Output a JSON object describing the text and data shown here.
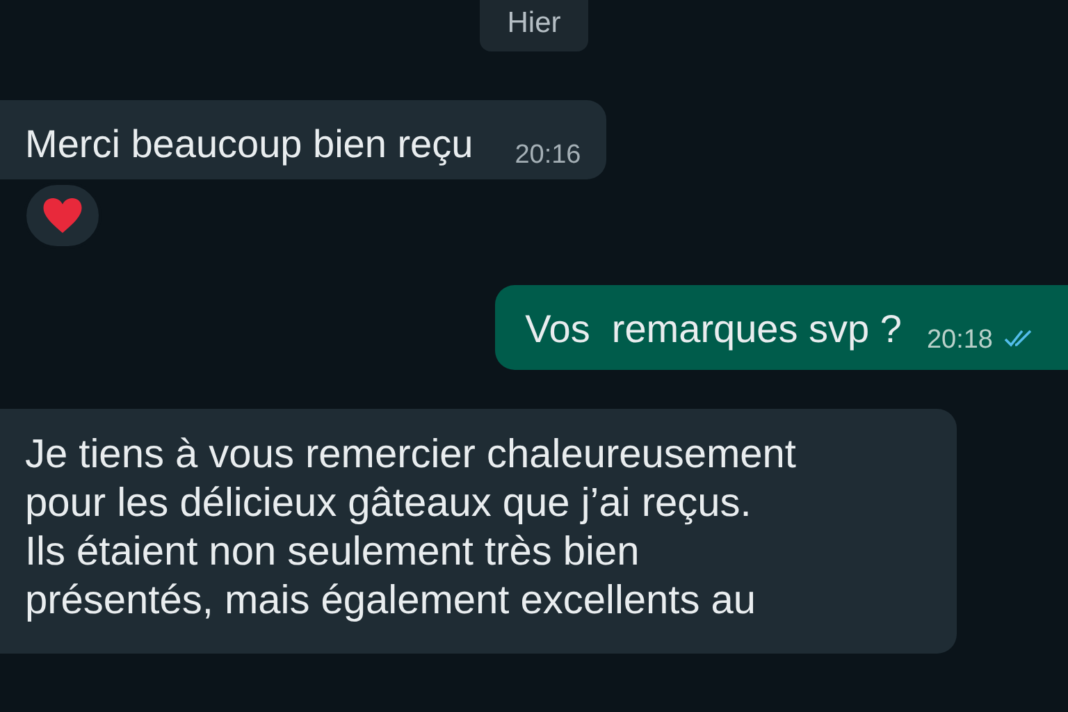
{
  "date_chip": "Hier",
  "messages": [
    {
      "kind": "incoming",
      "paragraphs": [
        "Merci beaucoup bien reçu"
      ],
      "time": "20:16",
      "reaction": true
    },
    {
      "kind": "outgoing",
      "paragraphs": [
        "Vos  remarques svp ?"
      ],
      "time": "20:18",
      "read": true
    },
    {
      "kind": "incoming",
      "paragraphs": [
        "Je tiens à vous remercier chaleureusement pour les délicieux gâteaux que j’ai reçus.",
        "Ils étaient non seulement très bien présentés, mais également excellents au"
      ]
    }
  ]
}
